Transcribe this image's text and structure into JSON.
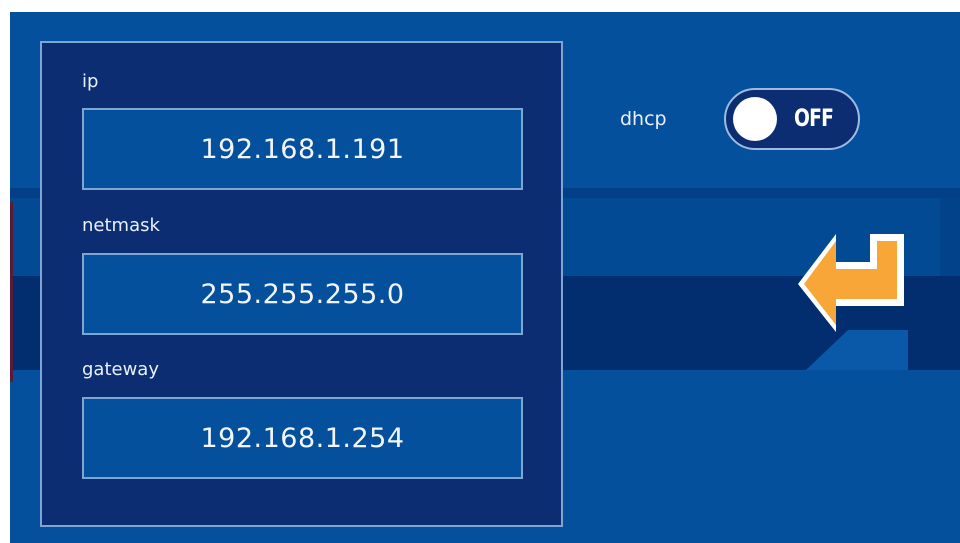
{
  "network_form": {
    "ip": {
      "label": "ip",
      "value": "192.168.1.191"
    },
    "netmask": {
      "label": "netmask",
      "value": "255.255.255.0"
    },
    "gateway": {
      "label": "gateway",
      "value": "192.168.1.254"
    }
  },
  "dhcp": {
    "label": "dhcp",
    "state": "OFF"
  },
  "icons": {
    "enter": "enter-arrow-icon"
  },
  "colors": {
    "background": "#04509c",
    "panel": "#0c2d72",
    "border": "#7fa6d2",
    "accent_arrow": "#f7a637"
  }
}
